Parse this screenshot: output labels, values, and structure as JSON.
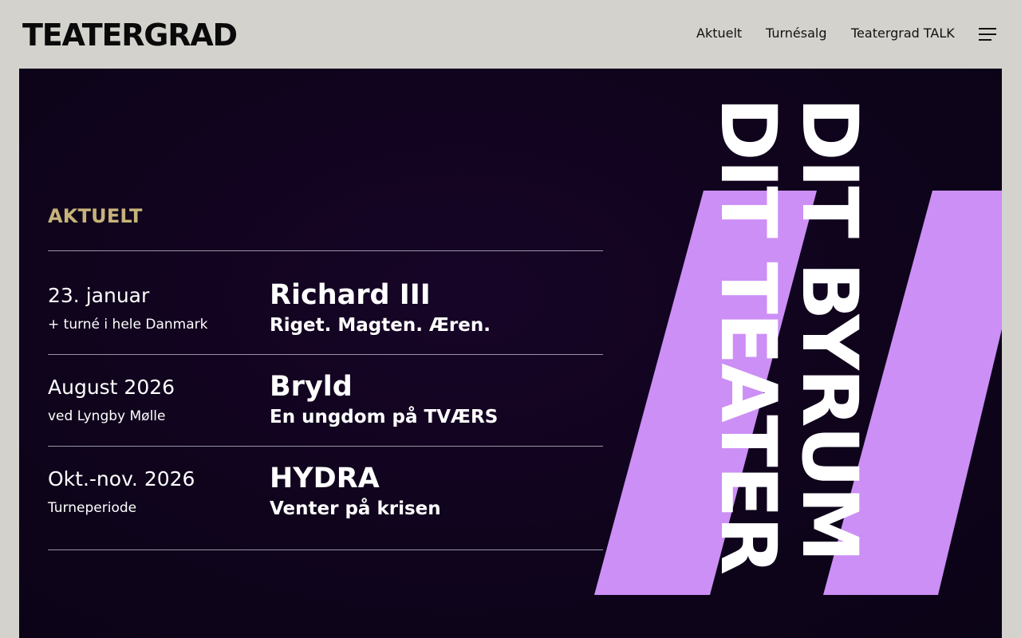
{
  "header": {
    "logo": "TEATERGRAD",
    "nav": [
      {
        "label": "Aktuelt"
      },
      {
        "label": "Turnésalg"
      },
      {
        "label": "Teatergrad TALK"
      }
    ],
    "menu_icon": "hamburger-menu-icon"
  },
  "hero": {
    "section_title": "AKTUELT",
    "events": [
      {
        "date": "23. januar",
        "sub": "+ turné i hele Danmark",
        "title": "Richard III",
        "tagline": "Riget. Magten. Æren."
      },
      {
        "date": "August 2026",
        "sub": "ved Lyngby Mølle",
        "title": "Bryld",
        "tagline": "En ungdom på TVÆRS"
      },
      {
        "date": "Okt.-nov. 2026",
        "sub": "Turneperiode",
        "title": "HYDRA",
        "tagline": "Venter på krisen"
      }
    ],
    "slogan_line1": "DIT BYRUM",
    "slogan_line2": "DIT TEATER"
  },
  "colors": {
    "page_background": "#d3d2cd",
    "hero_background": "#0f041c",
    "accent_gold": "#c7b37a",
    "accent_purple": "#cc8ff5",
    "text_white": "#ffffff"
  }
}
